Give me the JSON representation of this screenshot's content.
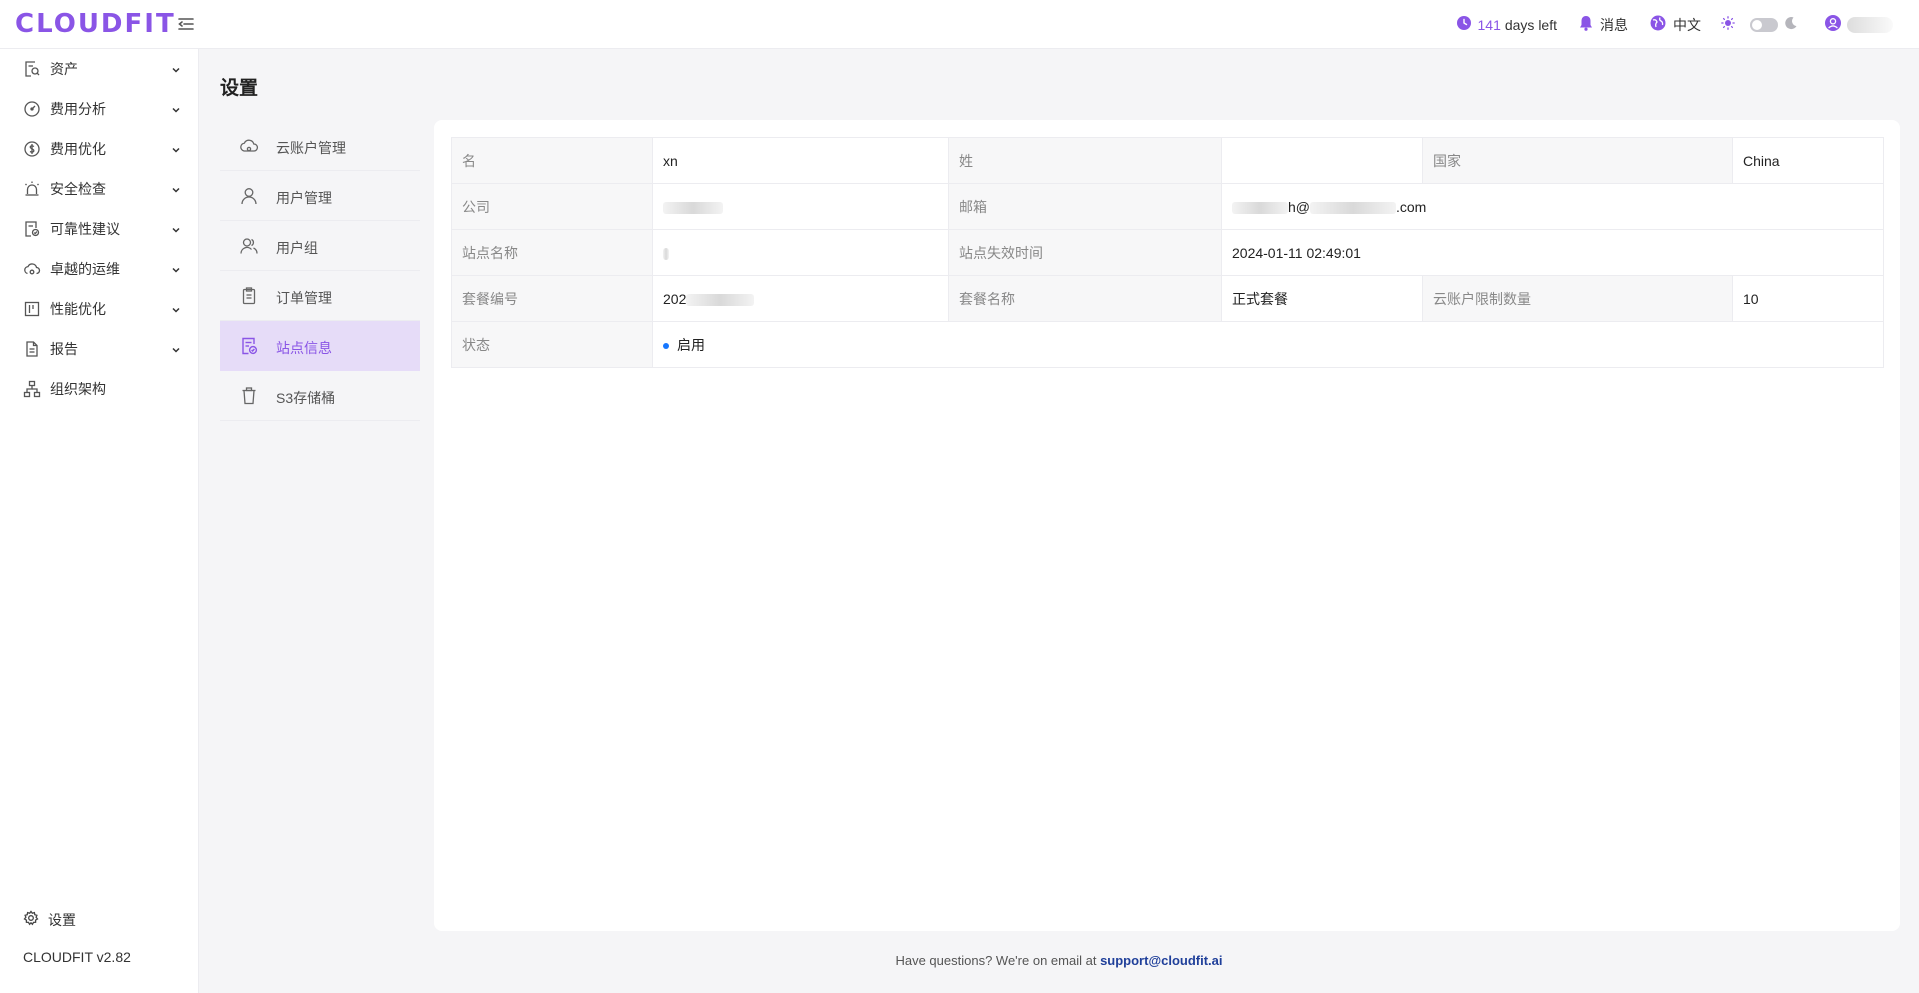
{
  "header": {
    "logo": "CLOUDFIT",
    "days_number": "141",
    "days_text": "days left",
    "messages_label": "消息",
    "language_label": "中文"
  },
  "sidebar": {
    "items": [
      {
        "label": "资产",
        "icon": "asset-search-icon"
      },
      {
        "label": "费用分析",
        "icon": "gauge-icon"
      },
      {
        "label": "费用优化",
        "icon": "dollar-circle-icon"
      },
      {
        "label": "安全检查",
        "icon": "alarm-light-icon"
      },
      {
        "label": "可靠性建议",
        "icon": "doc-check-icon"
      },
      {
        "label": "卓越的运维",
        "icon": "cloud-sync-icon"
      },
      {
        "label": "性能优化",
        "icon": "board-icon"
      },
      {
        "label": "报告",
        "icon": "report-icon"
      },
      {
        "label": "组织架构",
        "icon": "org-chart-icon"
      }
    ],
    "settings_label": "设置",
    "version": "CLOUDFIT v2.82"
  },
  "page": {
    "title": "设置"
  },
  "submenu": {
    "items": [
      {
        "label": "云账户管理",
        "icon": "cloud-icon"
      },
      {
        "label": "用户管理",
        "icon": "user-icon"
      },
      {
        "label": "用户组",
        "icon": "users-icon"
      },
      {
        "label": "订单管理",
        "icon": "clipboard-icon"
      },
      {
        "label": "站点信息",
        "icon": "site-info-icon",
        "active": true
      },
      {
        "label": "S3存储桶",
        "icon": "bucket-icon"
      }
    ]
  },
  "info": {
    "first_name_label": "名",
    "first_name_value": "xn",
    "last_name_label": "姓",
    "last_name_value": "",
    "country_label": "国家",
    "country_value": "China",
    "company_label": "公司",
    "email_label": "邮箱",
    "email_prefix": "h@",
    "email_suffix": ".com",
    "site_name_label": "站点名称",
    "site_expiry_label": "站点失效时间",
    "site_expiry_value": "2024-01-11 02:49:01",
    "plan_no_label": "套餐编号",
    "plan_no_value": "202",
    "plan_name_label": "套餐名称",
    "plan_name_value": "正式套餐",
    "account_limit_label": "云账户限制数量",
    "account_limit_value": "10",
    "status_label": "状态",
    "status_value": "启用"
  },
  "footer": {
    "text": "Have questions? We're on email at",
    "email": "support@cloudfit.ai"
  },
  "colors": {
    "accent": "#8a55e6",
    "active_bg": "#e6dcf8",
    "status_dot": "#1677ff",
    "link": "#1f3f9a"
  }
}
